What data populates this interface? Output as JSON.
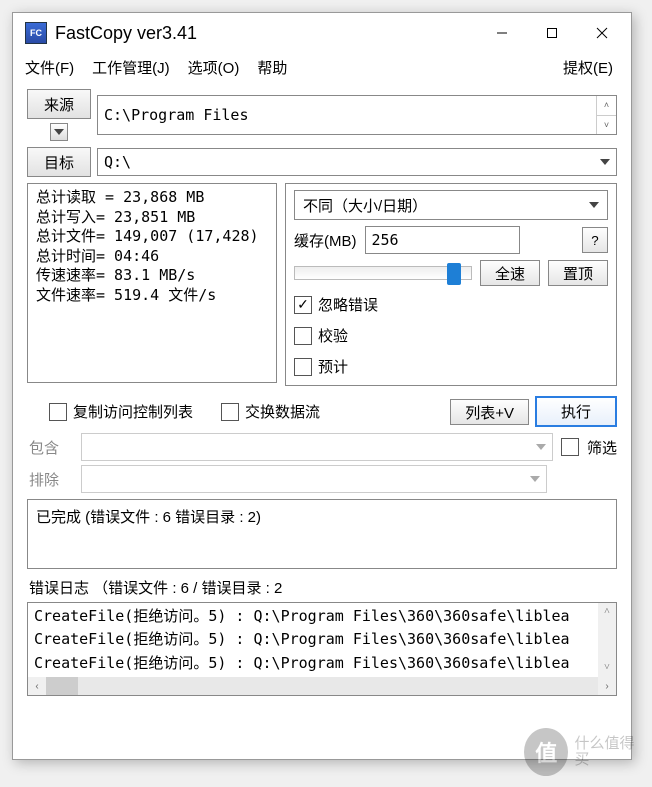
{
  "window": {
    "title": "FastCopy ver3.41"
  },
  "menu": {
    "file": "文件(F)",
    "job": "工作管理(J)",
    "options": "选项(O)",
    "help": "帮助",
    "auth": "提权(E)"
  },
  "path": {
    "source_btn": "来源",
    "source_value": "C:\\Program Files",
    "dest_btn": "目标",
    "dest_value": "Q:\\"
  },
  "stats_text": "总计读取 = 23,868 MB\n总计写入= 23,851 MB\n总计文件= 149,007 (17,428)\n总计时间= 04:46\n传速速率= 83.1 MB/s\n文件速率= 519.4 文件/s",
  "mode": {
    "selected": "不同（大小/日期）"
  },
  "buffer": {
    "label": "缓存(MB)",
    "value": "256",
    "help": "?"
  },
  "speed": {
    "full": "全速",
    "topmost": "置顶"
  },
  "checks": {
    "ignore_err": "忽略错误",
    "verify": "校验",
    "estimate": "预计"
  },
  "opts": {
    "acl": "复制访问控制列表",
    "ads": "交换数据流",
    "listv": "列表+V",
    "execute": "执行"
  },
  "filter": {
    "include": "包含",
    "exclude": "排除",
    "filter_cb": "筛选"
  },
  "log1": "已完成 (错误文件 : 6  错误目录 : 2)",
  "errheader": "错误日志 （错误文件 : 6 / 错误目录 : 2",
  "errlines": [
    "CreateFile(拒绝访问。5) : Q:\\Program Files\\360\\360safe\\liblea",
    "CreateFile(拒绝访问。5) : Q:\\Program Files\\360\\360safe\\liblea",
    "CreateFile(拒绝访问。5) : Q:\\Program Files\\360\\360safe\\liblea"
  ],
  "watermark": "什么值得买"
}
